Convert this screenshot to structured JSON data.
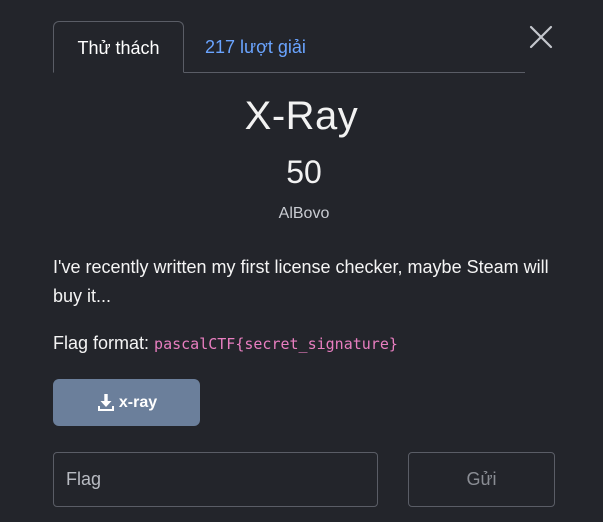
{
  "tabs": [
    {
      "label": "Thử thách",
      "active": true
    },
    {
      "label": "217 lượt giải",
      "active": false
    }
  ],
  "challenge": {
    "name": "X-Ray",
    "points": "50",
    "author": "AlBovo",
    "description": "I've recently written my first license checker, maybe Steam will buy it...",
    "flag_format_label": "Flag format:",
    "flag_format_value": "pascalCTF{secret_signature}"
  },
  "file": {
    "label": "x-ray",
    "icon": "download-icon"
  },
  "form": {
    "flag_placeholder": "Flag",
    "submit_label": "Gửi"
  },
  "colors": {
    "background": "#23252b",
    "link": "#6aa4ff",
    "code": "#e87ec0",
    "file_button": "#6b7f9b"
  },
  "icons": {
    "close": "close-icon"
  }
}
